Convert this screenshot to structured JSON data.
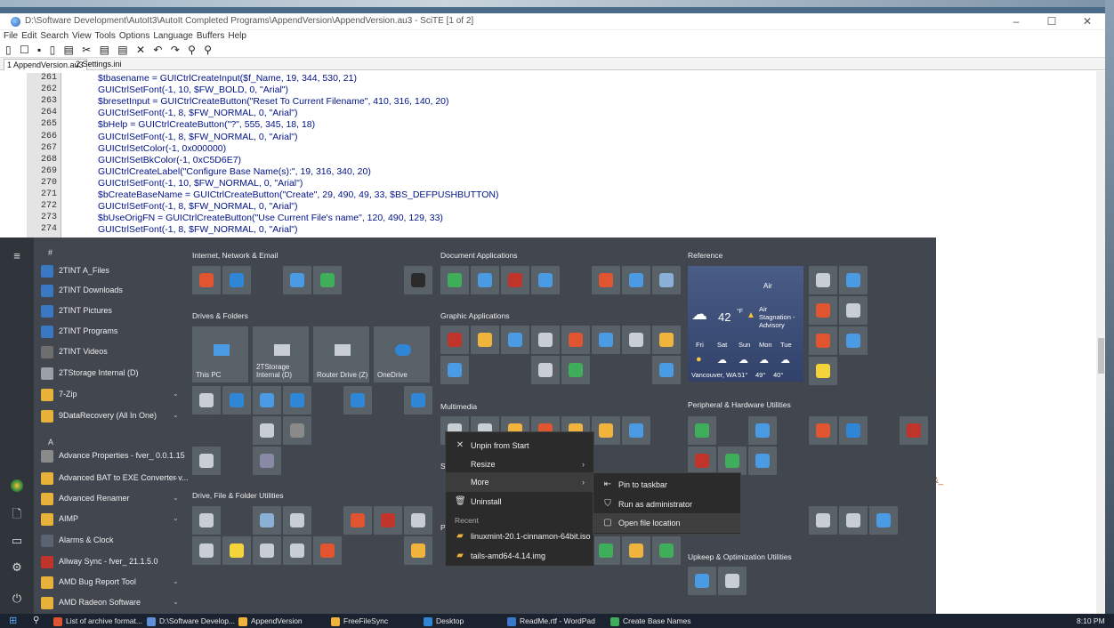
{
  "window": {
    "title": "D:\\Software Development\\AutoIt3\\AutoIt Completed Programs\\AppendVersion\\AppendVersion.au3 - SciTE [1 of 2]",
    "minimize": "–",
    "maximize": "☐",
    "close": "✕"
  },
  "menu": [
    "File",
    "Edit",
    "Search",
    "View",
    "Tools",
    "Options",
    "Language",
    "Buffers",
    "Help"
  ],
  "toolbar_glyphs": "▯ ☐ ▪ ▯ ▤ ✂ ▤ ▤ ✕ ↶ ↷ ⚲ ⚲",
  "tabs": [
    "1 AppendVersion.au3",
    "2 Settings.ini"
  ],
  "code": [
    {
      "n": "261",
      "t": "$tbasename = GUICtrlCreateInput($f_Name, 19, 344, 530, 21)"
    },
    {
      "n": "262",
      "t": "GUICtrlSetFont(-1, 10, $FW_BOLD, 0, \"Arial\")"
    },
    {
      "n": "263",
      "t": "$bresetInput = GUICtrlCreateButton(\"Reset To Current Filename\", 410, 316, 140, 20)"
    },
    {
      "n": "264",
      "t": "GUICtrlSetFont(-1, 8, $FW_NORMAL, 0, \"Arial\")"
    },
    {
      "n": "265",
      "t": "$bHelp = GUICtrlCreateButton(\"?\", 555, 345, 18, 18)"
    },
    {
      "n": "266",
      "t": "GUICtrlSetFont(-1, 8, $FW_NORMAL, 0, \"Arial\")"
    },
    {
      "n": "267",
      "t": "GUICtrlSetColor(-1, 0x000000)"
    },
    {
      "n": "268",
      "t": "GUICtrlSetBkColor(-1, 0xC5D6E7)"
    },
    {
      "n": "269",
      "t": "GUICtrlCreateLabel(\"Configure Base Name(s):\", 19, 316, 340, 20)"
    },
    {
      "n": "270",
      "t": "GUICtrlSetFont(-1, 10, $FW_NORMAL, 0, \"Arial\")"
    },
    {
      "n": "271",
      "t": "$bCreateBaseName = GUICtrlCreateButton(\"Create\", 29, 490, 49, 33, $BS_DEFPUSHBUTTON)"
    },
    {
      "n": "272",
      "t": "GUICtrlSetFont(-1, 8, $FW_NORMAL, 0, \"Arial\")"
    },
    {
      "n": "273",
      "t": "$bUseOrigFN = GUICtrlCreateButton(\"Use Current File's name\", 120, 490, 129, 33)"
    },
    {
      "n": "274",
      "t": "GUICtrlSetFont(-1, 8, $FW_NORMAL, 0, \"Arial\")"
    }
  ],
  "start": {
    "hash": "#",
    "letter_a": "A",
    "apps": [
      {
        "label": "2TINT A_Files",
        "color": "#3b78c4"
      },
      {
        "label": "2TINT Downloads",
        "color": "#3b78c4"
      },
      {
        "label": "2TINT Pictures",
        "color": "#3b78c4"
      },
      {
        "label": "2TINT Programs",
        "color": "#3b78c4"
      },
      {
        "label": "2TINT Videos",
        "color": "#6e6e6e"
      },
      {
        "label": "2TStorage Internal (D)",
        "color": "#9aa0a6"
      },
      {
        "label": "7-Zip",
        "color": "#e8b23a"
      },
      {
        "label": "9DataRecovery (All In One)",
        "color": "#e8b23a"
      },
      {
        "label": "Advance Properties - fver_ 0.0.1.15",
        "color": "#8a8a8a"
      },
      {
        "label": "Advanced BAT to EXE Converter v...",
        "color": "#e8b23a"
      },
      {
        "label": "Advanced Renamer",
        "color": "#e8b23a"
      },
      {
        "label": "AIMP",
        "color": "#e8b23a"
      },
      {
        "label": "Alarms & Clock",
        "color": "#5a6470"
      },
      {
        "label": "Allway Sync - fver_ 21.1.5.0",
        "color": "#c0342b"
      },
      {
        "label": "AMD Bug Report Tool",
        "color": "#e8b23a"
      },
      {
        "label": "AMD Radeon Software",
        "color": "#e8b23a"
      }
    ],
    "groups": {
      "internet": "Internet, Network & Email",
      "drives": "Drives & Folders",
      "drive_file": "Drive, File & Folder Utilities",
      "docs": "Document Applications",
      "graphic": "Graphic Applications",
      "multimedia": "Multimedia",
      "reference": "Reference",
      "peripheral": "Peripheral & Hardware Utilities",
      "upkeep": "Upkeep & Optimization Utilities",
      "sc": "Sc",
      "pr": "Pr"
    },
    "drive_tiles": [
      "This PC",
      "2TStorage Internal (D)",
      "Router Drive (Z)",
      "OneDrive"
    ],
    "weather": {
      "air": "Air",
      "temp": "42",
      "unit": "°F",
      "alert": "Air Stagnation - Advisory",
      "days": [
        "Fri",
        "Sat",
        "Sun",
        "Mon",
        "Tue"
      ],
      "location": "Vancouver, WA",
      "temps": [
        "51°",
        "49°",
        "40°"
      ]
    }
  },
  "context_menu": {
    "unpin": "Unpin from Start",
    "resize": "Resize",
    "more": "More",
    "uninstall": "Uninstall",
    "recent": "Recent",
    "recent_items": [
      "linuxmint-20.1-cinnamon-64bit.iso",
      "tails-amd64-4.14.img"
    ],
    "sub": [
      "Pin to taskbar",
      "Run as administrator",
      "Open file location"
    ]
  },
  "taskbar": {
    "items": [
      {
        "label": "List of archive format...",
        "color": "#e0542f"
      },
      {
        "label": "D:\\Software Develop...",
        "color": "#5f8fd6"
      },
      {
        "label": "AppendVersion",
        "color": "#f0b43c"
      },
      {
        "label": "FreeFileSync",
        "color": "#f0b43c"
      },
      {
        "label": "Desktop",
        "color": "#2f86d6"
      },
      {
        "label": "ReadMe.rtf - WordPad",
        "color": "#3a78c8"
      },
      {
        "label": "Create Base Names",
        "color": "#3fae5b"
      }
    ],
    "clock": "8:10 PM"
  },
  "side_marks": {
    "amp": "&_",
    "paren": ")"
  }
}
